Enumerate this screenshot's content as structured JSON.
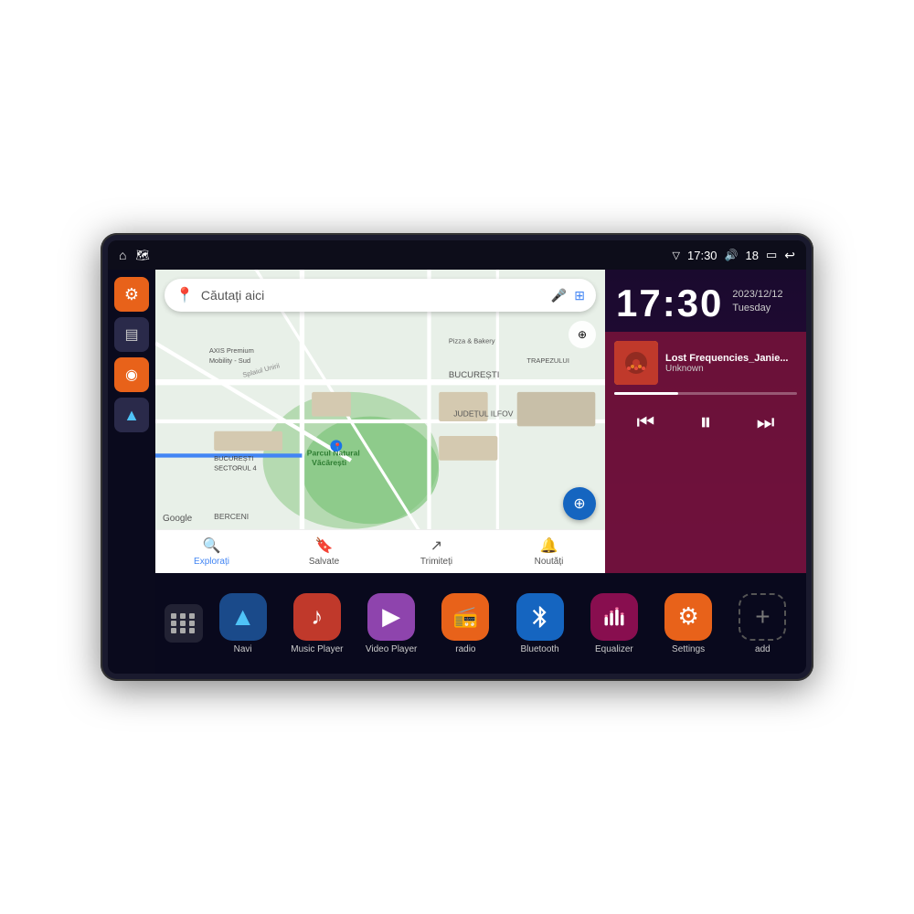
{
  "device": {
    "status_bar": {
      "home_icon": "⌂",
      "maps_icon": "🗺",
      "wifi_icon": "▽",
      "time": "17:30",
      "volume_icon": "🔊",
      "battery_num": "18",
      "battery_icon": "🔋",
      "back_icon": "↩"
    },
    "sidebar": {
      "buttons": [
        {
          "id": "settings",
          "icon": "⚙",
          "color": "orange"
        },
        {
          "id": "apps",
          "icon": "▤",
          "color": "dark"
        },
        {
          "id": "map",
          "icon": "◉",
          "color": "orange"
        },
        {
          "id": "nav",
          "icon": "▲",
          "color": "dark"
        }
      ]
    },
    "map": {
      "search_placeholder": "Căutați aici",
      "search_icon": "📍",
      "locations": [
        "AXIS Premium Mobility - Sud",
        "Parcul Natural Văcărești",
        "Pizza & Bakery",
        "TRAPEZULUI",
        "BUCUREȘTI",
        "JUDEȚUL ILFOV",
        "BERCENI",
        "BUCUREȘTI SECTORUL 4"
      ],
      "bottom_nav": [
        {
          "icon": "🔍",
          "label": "Explorați",
          "active": true
        },
        {
          "icon": "🔖",
          "label": "Salvate",
          "active": false
        },
        {
          "icon": "↗",
          "label": "Trimiteți",
          "active": false
        },
        {
          "icon": "🔔",
          "label": "Noutăți",
          "active": false
        }
      ]
    },
    "clock": {
      "time": "17:30",
      "date": "2023/12/12",
      "day": "Tuesday"
    },
    "music": {
      "title": "Lost Frequencies_Janie...",
      "artist": "Unknown",
      "prev_icon": "⏮",
      "play_icon": "⏸",
      "next_icon": "⏭",
      "progress": 35
    },
    "apps": [
      {
        "id": "navi",
        "label": "Navi",
        "icon": "▲",
        "style": "icon-navi"
      },
      {
        "id": "music-player",
        "label": "Music Player",
        "icon": "♪",
        "style": "icon-music"
      },
      {
        "id": "video-player",
        "label": "Video Player",
        "icon": "▶",
        "style": "icon-video"
      },
      {
        "id": "radio",
        "label": "radio",
        "icon": "📻",
        "style": "icon-radio"
      },
      {
        "id": "bluetooth",
        "label": "Bluetooth",
        "icon": "✦",
        "style": "icon-bt"
      },
      {
        "id": "equalizer",
        "label": "Equalizer",
        "icon": "≡",
        "style": "icon-eq"
      },
      {
        "id": "settings",
        "label": "Settings",
        "icon": "⚙",
        "style": "icon-settings"
      },
      {
        "id": "add",
        "label": "add",
        "icon": "+",
        "style": "icon-add"
      }
    ]
  }
}
